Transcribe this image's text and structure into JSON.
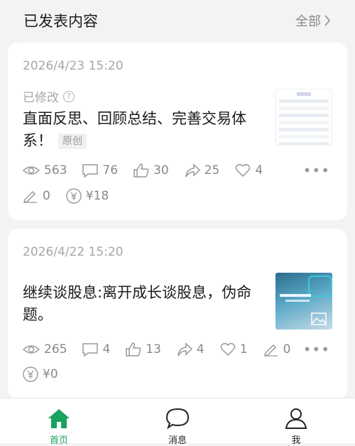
{
  "header": {
    "title": "已发表内容",
    "all_label": "全部"
  },
  "articles": [
    {
      "date": "2026/4/23 15:20",
      "edited_label": "已修改",
      "title": "直面反思、回顾总结、完善交易体系！",
      "tag": "原创",
      "stats": {
        "views": "563",
        "comments": "76",
        "likes": "30",
        "shares": "25",
        "favorites": "4",
        "edits": "0",
        "rewards": "¥18"
      }
    },
    {
      "date": "2026/4/22 15:20",
      "title": "继续谈股息:离开成长谈股息，伪命题。",
      "stats": {
        "views": "265",
        "comments": "4",
        "likes": "13",
        "shares": "4",
        "favorites": "1",
        "edits": "0",
        "rewards": "¥0"
      }
    }
  ],
  "nav": {
    "home": "首页",
    "messages": "消息",
    "me": "我"
  },
  "colors": {
    "accent": "#1aa260",
    "background": "#f2f3f5",
    "muted": "#a7a7a7"
  }
}
